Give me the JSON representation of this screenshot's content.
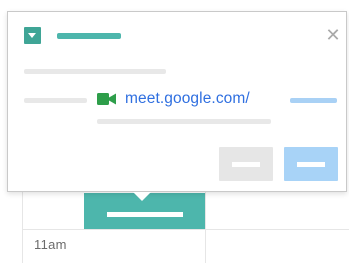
{
  "calendar": {
    "time_label": "11am",
    "event_color": "#4db6ac"
  },
  "popup": {
    "icon": "calendar-chip-icon",
    "close_icon": "close-icon",
    "close_glyph": "✕",
    "meet_link": "meet.google.com/",
    "meet_icon": "video-camera-icon",
    "link_color": "#2f6fe0",
    "primary_button_color": "#a8d3f7",
    "secondary_button_color": "#e6e6e6"
  }
}
